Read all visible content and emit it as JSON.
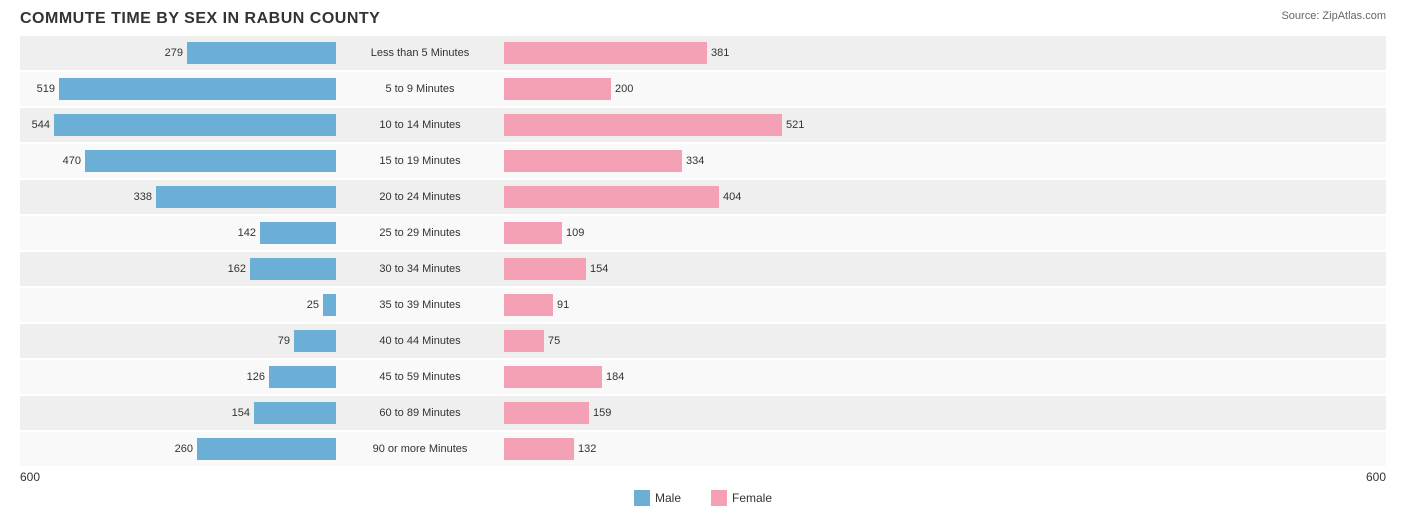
{
  "title": "COMMUTE TIME BY SEX IN RABUN COUNTY",
  "source": "Source: ZipAtlas.com",
  "scale": 0.5515,
  "maxValue": 600,
  "axisLeft": "600",
  "axisRight": "600",
  "legend": {
    "male_label": "Male",
    "female_label": "Female",
    "male_color": "#6baed6",
    "female_color": "#f4a0b5"
  },
  "rows": [
    {
      "label": "Less than 5 Minutes",
      "male": 279,
      "female": 381
    },
    {
      "label": "5 to 9 Minutes",
      "male": 519,
      "female": 200
    },
    {
      "label": "10 to 14 Minutes",
      "male": 544,
      "female": 521
    },
    {
      "label": "15 to 19 Minutes",
      "male": 470,
      "female": 334
    },
    {
      "label": "20 to 24 Minutes",
      "male": 338,
      "female": 404
    },
    {
      "label": "25 to 29 Minutes",
      "male": 142,
      "female": 109
    },
    {
      "label": "30 to 34 Minutes",
      "male": 162,
      "female": 154
    },
    {
      "label": "35 to 39 Minutes",
      "male": 25,
      "female": 91
    },
    {
      "label": "40 to 44 Minutes",
      "male": 79,
      "female": 75
    },
    {
      "label": "45 to 59 Minutes",
      "male": 126,
      "female": 184
    },
    {
      "label": "60 to 89 Minutes",
      "male": 154,
      "female": 159
    },
    {
      "label": "90 or more Minutes",
      "male": 260,
      "female": 132
    }
  ]
}
